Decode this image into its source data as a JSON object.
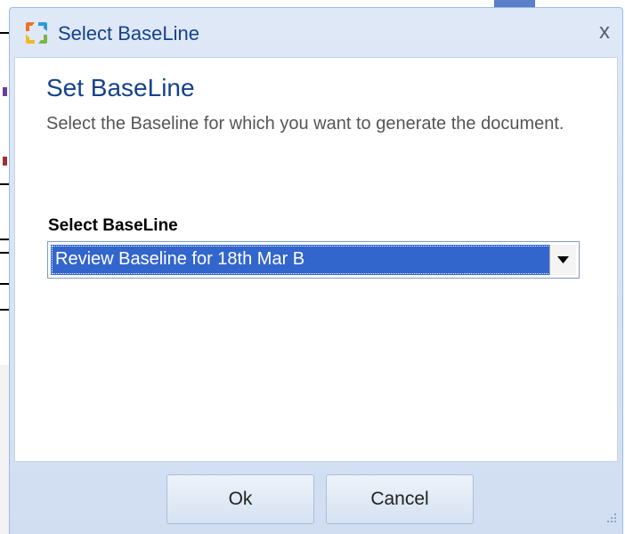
{
  "window": {
    "title": "Select BaseLine",
    "close_symbol": "x"
  },
  "content": {
    "heading": "Set BaseLine",
    "description": "Select the Baseline for which you want to generate the document."
  },
  "baseline_field": {
    "label": "Select BaseLine",
    "selected_value": "Review Baseline for 18th Mar B"
  },
  "buttons": {
    "ok_label": "Ok",
    "cancel_label": "Cancel"
  },
  "icons": {
    "app": "app-logo-icon",
    "close": "close-icon",
    "dropdown": "chevron-down-icon",
    "resize": "resize-grip-icon"
  },
  "colors": {
    "title_text": "#15428b",
    "selection_highlight": "#3366cc",
    "dialog_frame": "#dfe8f6"
  }
}
